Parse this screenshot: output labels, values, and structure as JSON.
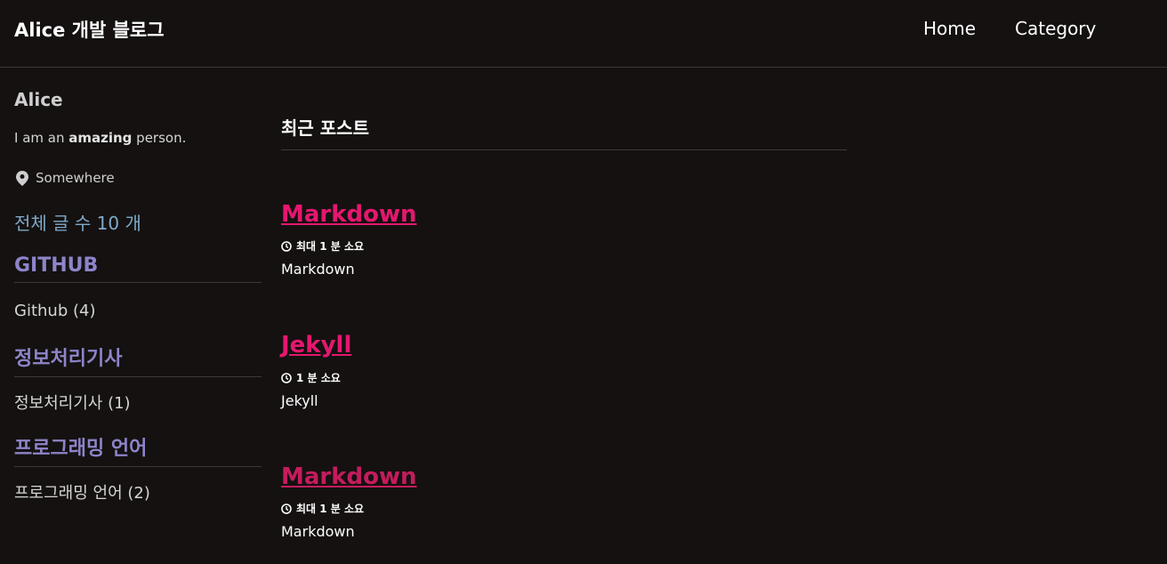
{
  "header": {
    "site_title": "Alice 개발 블로그",
    "nav": [
      "Home",
      "Category"
    ]
  },
  "sidebar": {
    "author_name": "Alice",
    "bio_prefix": "I am an ",
    "bio_bold": "amazing",
    "bio_suffix": " person.",
    "location": "Somewhere",
    "location_icon": "map-marker-icon",
    "post_count": "전체 글 수 10 개",
    "categories": [
      {
        "heading": "GITHUB",
        "item": "Github (4)"
      },
      {
        "heading": "정보처리기사",
        "item": "정보처리기사 (1)"
      },
      {
        "heading": "프로그래밍 언어",
        "item": "프로그래밍 언어 (2)"
      }
    ]
  },
  "main": {
    "section_title": "최근 포스트",
    "posts": [
      {
        "title": "Markdown",
        "meta": "최대 1 분 소요",
        "excerpt": "Markdown"
      },
      {
        "title": "Jekyll",
        "meta": "1 분 소요",
        "excerpt": "Jekyll"
      },
      {
        "title": "Markdown",
        "meta": "최대 1 분 소요",
        "excerpt": "Markdown"
      }
    ],
    "meta_icon": "clock-icon"
  },
  "colors": {
    "background": "#141110",
    "post_link": "#e5176f",
    "category_heading": "#8e84c9",
    "post_count": "#7fa9c9"
  }
}
